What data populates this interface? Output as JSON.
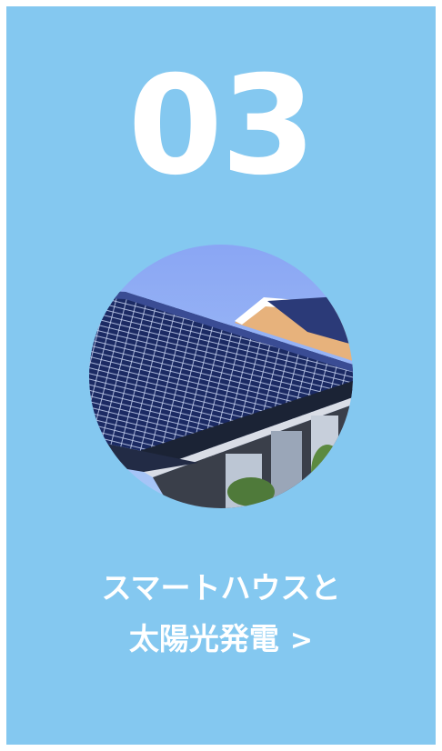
{
  "card": {
    "number": "03",
    "caption_line1": "スマートハウスと",
    "caption_line2": "太陽光発電",
    "chevron": ">",
    "image_subject": "solar-panel-roof-photo",
    "colors": {
      "background": "#84c8f0",
      "text": "#ffffff",
      "sky": "#7fb0f2",
      "panel": "#1d2c66",
      "roof_wall": "#e9b27a"
    }
  }
}
